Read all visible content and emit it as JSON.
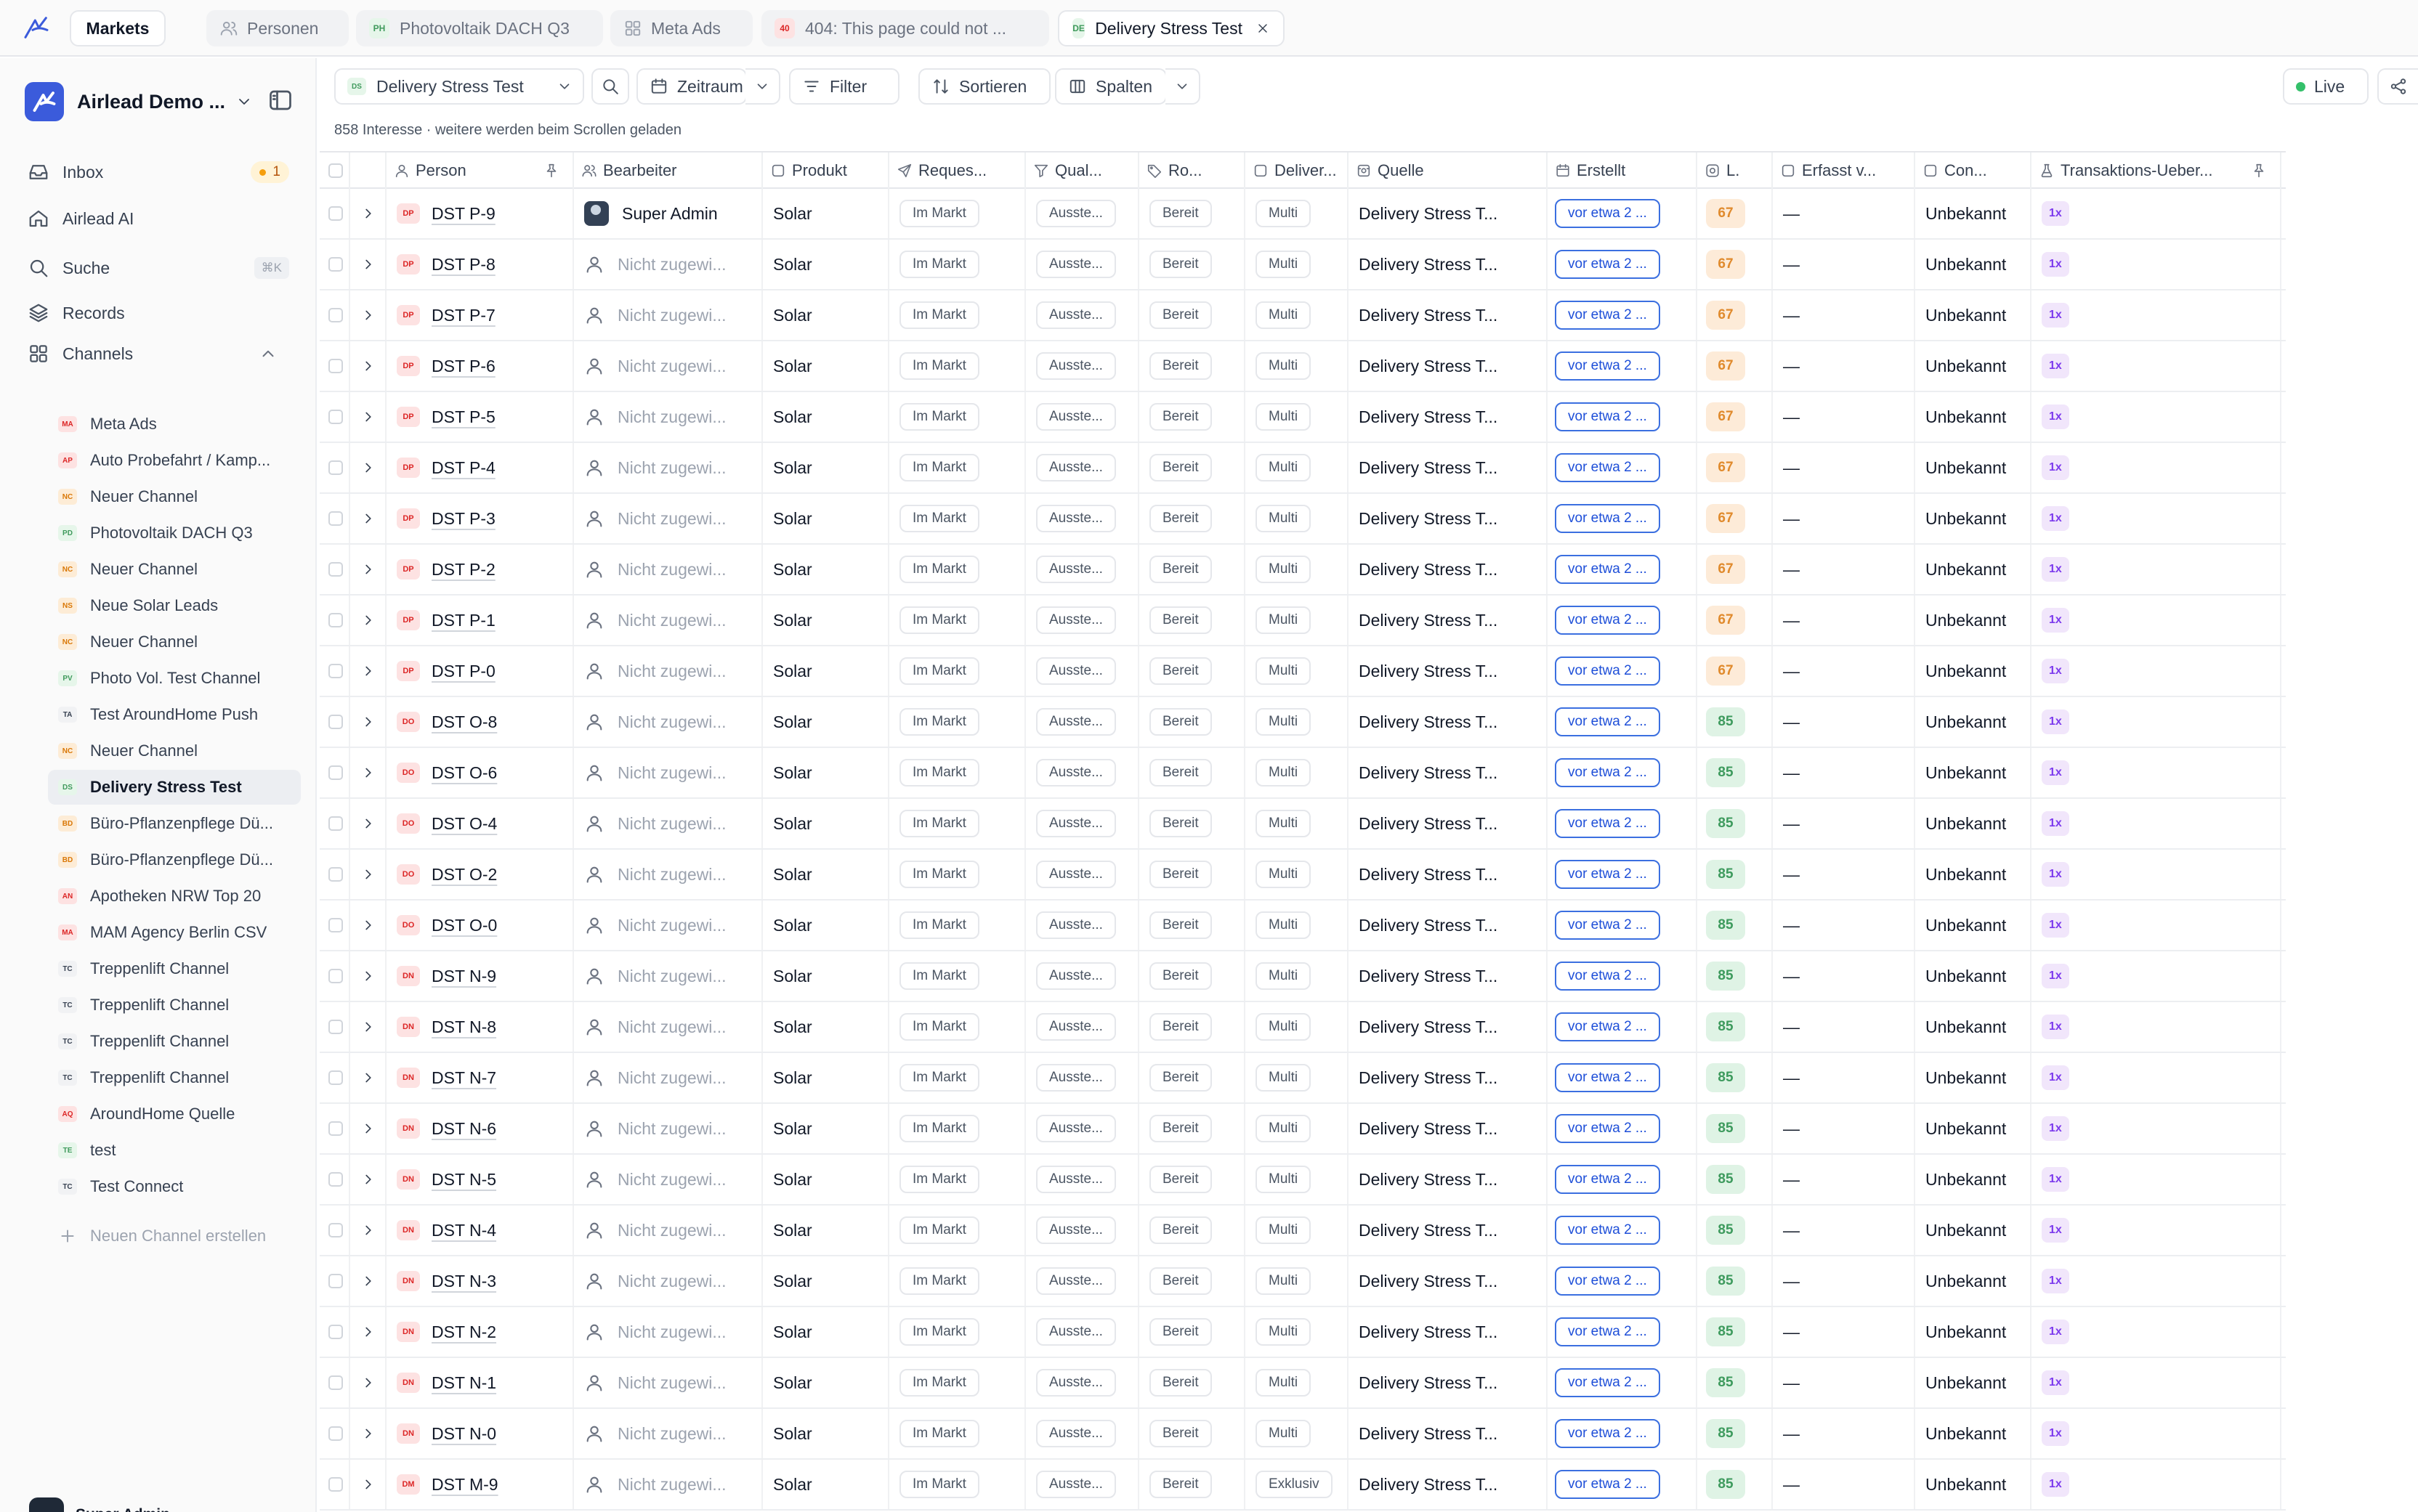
{
  "tabs": [
    {
      "label": "Markets",
      "kind": "text",
      "badge": ""
    },
    {
      "label": "Personen",
      "kind": "users-icon",
      "badge": ""
    },
    {
      "label": "Photovoltaik DACH Q3",
      "kind": "badge",
      "badge": "PH",
      "badge_bg": "#e6f6ea",
      "badge_fg": "#3f9a5c"
    },
    {
      "label": "Meta Ads",
      "kind": "grid-icon",
      "badge": ""
    },
    {
      "label": "404: This page could not ...",
      "kind": "badge",
      "badge": "40",
      "badge_bg": "#fde2e2",
      "badge_fg": "#dc2626"
    },
    {
      "label": "Delivery Stress Test",
      "kind": "badge",
      "badge": "DE",
      "badge_bg": "#e6f6ea",
      "badge_fg": "#3f9a5c"
    }
  ],
  "workspace": {
    "name": "Airlead Demo ..."
  },
  "nav": [
    {
      "label": "Inbox",
      "icon": "inbox-icon",
      "count": "1"
    },
    {
      "label": "Airlead AI",
      "icon": "home-icon"
    },
    {
      "label": "Suche",
      "icon": "search-icon",
      "shortcut": "⌘K"
    },
    {
      "label": "Records",
      "icon": "layers-icon"
    },
    {
      "label": "Channels",
      "icon": "grid-icon"
    }
  ],
  "channels": [
    {
      "badge": "MA",
      "label": "Meta Ads",
      "bg": "#fde2e2",
      "fg": "#dc2626"
    },
    {
      "badge": "AP",
      "label": "Auto Probefahrt / Kamp...",
      "bg": "#fde2e2",
      "fg": "#dc2626"
    },
    {
      "badge": "NC",
      "label": "Neuer Channel",
      "bg": "#fdecd6",
      "fg": "#d97706"
    },
    {
      "badge": "PD",
      "label": "Photovoltaik DACH Q3",
      "bg": "#e6f6ea",
      "fg": "#3f9a5c"
    },
    {
      "badge": "NC",
      "label": "Neuer Channel",
      "bg": "#fdecd6",
      "fg": "#d97706"
    },
    {
      "badge": "NS",
      "label": "Neue Solar Leads",
      "bg": "#fdecd6",
      "fg": "#d97706"
    },
    {
      "badge": "NC",
      "label": "Neuer Channel",
      "bg": "#fdecd6",
      "fg": "#d97706"
    },
    {
      "badge": "PV",
      "label": "Photo Vol. Test Channel",
      "bg": "#e6f6ea",
      "fg": "#3f9a5c"
    },
    {
      "badge": "TA",
      "label": "Test AroundHome Push",
      "bg": "#f1f2f4",
      "fg": "#374151"
    },
    {
      "badge": "NC",
      "label": "Neuer Channel",
      "bg": "#fdecd6",
      "fg": "#d97706"
    },
    {
      "badge": "DS",
      "label": "Delivery Stress Test",
      "bg": "#e6f6ea",
      "fg": "#3f9a5c",
      "active": true
    },
    {
      "badge": "BD",
      "label": "Büro-Pflanzenpflege Dü...",
      "bg": "#fdecd6",
      "fg": "#d97706"
    },
    {
      "badge": "BD",
      "label": "Büro-Pflanzenpflege Dü...",
      "bg": "#fdecd6",
      "fg": "#d97706"
    },
    {
      "badge": "AN",
      "label": "Apotheken NRW Top 20",
      "bg": "#fde2e2",
      "fg": "#dc2626"
    },
    {
      "badge": "MA",
      "label": "MAM Agency Berlin CSV",
      "bg": "#fde2e2",
      "fg": "#dc2626"
    },
    {
      "badge": "TC",
      "label": "Treppenlift Channel",
      "bg": "#f1f2f4",
      "fg": "#374151"
    },
    {
      "badge": "TC",
      "label": "Treppenlift Channel",
      "bg": "#f1f2f4",
      "fg": "#374151"
    },
    {
      "badge": "TC",
      "label": "Treppenlift Channel",
      "bg": "#f1f2f4",
      "fg": "#374151"
    },
    {
      "badge": "TC",
      "label": "Treppenlift Channel",
      "bg": "#f1f2f4",
      "fg": "#374151"
    },
    {
      "badge": "AQ",
      "label": "AroundHome Quelle",
      "bg": "#fde2e2",
      "fg": "#dc2626"
    },
    {
      "badge": "TE",
      "label": "test",
      "bg": "#e6f6ea",
      "fg": "#3f9a5c"
    },
    {
      "badge": "TC",
      "label": "Test Connect",
      "bg": "#f1f2f4",
      "fg": "#374151"
    }
  ],
  "add_channel_label": "Neuen Channel erstellen",
  "user": {
    "name": "Super Admin"
  },
  "toolbar": {
    "view_badge": "DS",
    "view_label": "Delivery Stress Test",
    "zeitraum": "Zeitraum",
    "filter": "Filter",
    "sortieren": "Sortieren",
    "spalten": "Spalten",
    "live": "Live"
  },
  "info_text": "858 Interesse · weitere werden beim Scrollen geladen",
  "columns": [
    {
      "label": "Person",
      "icon": "user-icon",
      "pin": true
    },
    {
      "label": "Bearbeiter",
      "icon": "users-icon"
    },
    {
      "label": "Produkt",
      "icon": "box-icon"
    },
    {
      "label": "Reques...",
      "icon": "send-icon"
    },
    {
      "label": "Qual...",
      "icon": "funnel-icon"
    },
    {
      "label": "Ro...",
      "icon": "tag-icon"
    },
    {
      "label": "Deliver...",
      "icon": "box-icon"
    },
    {
      "label": "Quelle",
      "icon": "source-icon"
    },
    {
      "label": "Erstellt",
      "icon": "calendar-icon"
    },
    {
      "label": "L.",
      "icon": "target-icon"
    },
    {
      "label": "Erfasst v...",
      "icon": "box-icon"
    },
    {
      "label": "Con...",
      "icon": "box-icon"
    },
    {
      "label": "Transaktions-Ueber...",
      "icon": "flask-icon",
      "pin": true
    }
  ],
  "rows": [
    {
      "badge": "DP",
      "name": "DST P-9",
      "assignee": "Super Admin",
      "assigned": true,
      "product": "Solar",
      "request": "Im Markt",
      "qual": "Ausste...",
      "role": "Bereit",
      "delivery": "Multi",
      "source": "Delivery Stress T...",
      "created": "vor etwa 2 ...",
      "score": "67",
      "erfasst": "—",
      "con": "Unbekannt",
      "tx": "1x"
    },
    {
      "badge": "DP",
      "name": "DST P-8",
      "assignee": "Nicht zugewi...",
      "assigned": false,
      "product": "Solar",
      "request": "Im Markt",
      "qual": "Ausste...",
      "role": "Bereit",
      "delivery": "Multi",
      "source": "Delivery Stress T...",
      "created": "vor etwa 2 ...",
      "score": "67",
      "erfasst": "—",
      "con": "Unbekannt",
      "tx": "1x"
    },
    {
      "badge": "DP",
      "name": "DST P-7",
      "assignee": "Nicht zugewi...",
      "assigned": false,
      "product": "Solar",
      "request": "Im Markt",
      "qual": "Ausste...",
      "role": "Bereit",
      "delivery": "Multi",
      "source": "Delivery Stress T...",
      "created": "vor etwa 2 ...",
      "score": "67",
      "erfasst": "—",
      "con": "Unbekannt",
      "tx": "1x"
    },
    {
      "badge": "DP",
      "name": "DST P-6",
      "assignee": "Nicht zugewi...",
      "assigned": false,
      "product": "Solar",
      "request": "Im Markt",
      "qual": "Ausste...",
      "role": "Bereit",
      "delivery": "Multi",
      "source": "Delivery Stress T...",
      "created": "vor etwa 2 ...",
      "score": "67",
      "erfasst": "—",
      "con": "Unbekannt",
      "tx": "1x"
    },
    {
      "badge": "DP",
      "name": "DST P-5",
      "assignee": "Nicht zugewi...",
      "assigned": false,
      "product": "Solar",
      "request": "Im Markt",
      "qual": "Ausste...",
      "role": "Bereit",
      "delivery": "Multi",
      "source": "Delivery Stress T...",
      "created": "vor etwa 2 ...",
      "score": "67",
      "erfasst": "—",
      "con": "Unbekannt",
      "tx": "1x"
    },
    {
      "badge": "DP",
      "name": "DST P-4",
      "assignee": "Nicht zugewi...",
      "assigned": false,
      "product": "Solar",
      "request": "Im Markt",
      "qual": "Ausste...",
      "role": "Bereit",
      "delivery": "Multi",
      "source": "Delivery Stress T...",
      "created": "vor etwa 2 ...",
      "score": "67",
      "erfasst": "—",
      "con": "Unbekannt",
      "tx": "1x"
    },
    {
      "badge": "DP",
      "name": "DST P-3",
      "assignee": "Nicht zugewi...",
      "assigned": false,
      "product": "Solar",
      "request": "Im Markt",
      "qual": "Ausste...",
      "role": "Bereit",
      "delivery": "Multi",
      "source": "Delivery Stress T...",
      "created": "vor etwa 2 ...",
      "score": "67",
      "erfasst": "—",
      "con": "Unbekannt",
      "tx": "1x"
    },
    {
      "badge": "DP",
      "name": "DST P-2",
      "assignee": "Nicht zugewi...",
      "assigned": false,
      "product": "Solar",
      "request": "Im Markt",
      "qual": "Ausste...",
      "role": "Bereit",
      "delivery": "Multi",
      "source": "Delivery Stress T...",
      "created": "vor etwa 2 ...",
      "score": "67",
      "erfasst": "—",
      "con": "Unbekannt",
      "tx": "1x"
    },
    {
      "badge": "DP",
      "name": "DST P-1",
      "assignee": "Nicht zugewi...",
      "assigned": false,
      "product": "Solar",
      "request": "Im Markt",
      "qual": "Ausste...",
      "role": "Bereit",
      "delivery": "Multi",
      "source": "Delivery Stress T...",
      "created": "vor etwa 2 ...",
      "score": "67",
      "erfasst": "—",
      "con": "Unbekannt",
      "tx": "1x"
    },
    {
      "badge": "DP",
      "name": "DST P-0",
      "assignee": "Nicht zugewi...",
      "assigned": false,
      "product": "Solar",
      "request": "Im Markt",
      "qual": "Ausste...",
      "role": "Bereit",
      "delivery": "Multi",
      "source": "Delivery Stress T...",
      "created": "vor etwa 2 ...",
      "score": "67",
      "erfasst": "—",
      "con": "Unbekannt",
      "tx": "1x"
    },
    {
      "badge": "DO",
      "name": "DST O-8",
      "assignee": "Nicht zugewi...",
      "assigned": false,
      "product": "Solar",
      "request": "Im Markt",
      "qual": "Ausste...",
      "role": "Bereit",
      "delivery": "Multi",
      "source": "Delivery Stress T...",
      "created": "vor etwa 2 ...",
      "score": "85",
      "erfasst": "—",
      "con": "Unbekannt",
      "tx": "1x"
    },
    {
      "badge": "DO",
      "name": "DST O-6",
      "assignee": "Nicht zugewi...",
      "assigned": false,
      "product": "Solar",
      "request": "Im Markt",
      "qual": "Ausste...",
      "role": "Bereit",
      "delivery": "Multi",
      "source": "Delivery Stress T...",
      "created": "vor etwa 2 ...",
      "score": "85",
      "erfasst": "—",
      "con": "Unbekannt",
      "tx": "1x"
    },
    {
      "badge": "DO",
      "name": "DST O-4",
      "assignee": "Nicht zugewi...",
      "assigned": false,
      "product": "Solar",
      "request": "Im Markt",
      "qual": "Ausste...",
      "role": "Bereit",
      "delivery": "Multi",
      "source": "Delivery Stress T...",
      "created": "vor etwa 2 ...",
      "score": "85",
      "erfasst": "—",
      "con": "Unbekannt",
      "tx": "1x"
    },
    {
      "badge": "DO",
      "name": "DST O-2",
      "assignee": "Nicht zugewi...",
      "assigned": false,
      "product": "Solar",
      "request": "Im Markt",
      "qual": "Ausste...",
      "role": "Bereit",
      "delivery": "Multi",
      "source": "Delivery Stress T...",
      "created": "vor etwa 2 ...",
      "score": "85",
      "erfasst": "—",
      "con": "Unbekannt",
      "tx": "1x"
    },
    {
      "badge": "DO",
      "name": "DST O-0",
      "assignee": "Nicht zugewi...",
      "assigned": false,
      "product": "Solar",
      "request": "Im Markt",
      "qual": "Ausste...",
      "role": "Bereit",
      "delivery": "Multi",
      "source": "Delivery Stress T...",
      "created": "vor etwa 2 ...",
      "score": "85",
      "erfasst": "—",
      "con": "Unbekannt",
      "tx": "1x"
    },
    {
      "badge": "DN",
      "name": "DST N-9",
      "assignee": "Nicht zugewi...",
      "assigned": false,
      "product": "Solar",
      "request": "Im Markt",
      "qual": "Ausste...",
      "role": "Bereit",
      "delivery": "Multi",
      "source": "Delivery Stress T...",
      "created": "vor etwa 2 ...",
      "score": "85",
      "erfasst": "—",
      "con": "Unbekannt",
      "tx": "1x"
    },
    {
      "badge": "DN",
      "name": "DST N-8",
      "assignee": "Nicht zugewi...",
      "assigned": false,
      "product": "Solar",
      "request": "Im Markt",
      "qual": "Ausste...",
      "role": "Bereit",
      "delivery": "Multi",
      "source": "Delivery Stress T...",
      "created": "vor etwa 2 ...",
      "score": "85",
      "erfasst": "—",
      "con": "Unbekannt",
      "tx": "1x"
    },
    {
      "badge": "DN",
      "name": "DST N-7",
      "assignee": "Nicht zugewi...",
      "assigned": false,
      "product": "Solar",
      "request": "Im Markt",
      "qual": "Ausste...",
      "role": "Bereit",
      "delivery": "Multi",
      "source": "Delivery Stress T...",
      "created": "vor etwa 2 ...",
      "score": "85",
      "erfasst": "—",
      "con": "Unbekannt",
      "tx": "1x"
    },
    {
      "badge": "DN",
      "name": "DST N-6",
      "assignee": "Nicht zugewi...",
      "assigned": false,
      "product": "Solar",
      "request": "Im Markt",
      "qual": "Ausste...",
      "role": "Bereit",
      "delivery": "Multi",
      "source": "Delivery Stress T...",
      "created": "vor etwa 2 ...",
      "score": "85",
      "erfasst": "—",
      "con": "Unbekannt",
      "tx": "1x"
    },
    {
      "badge": "DN",
      "name": "DST N-5",
      "assignee": "Nicht zugewi...",
      "assigned": false,
      "product": "Solar",
      "request": "Im Markt",
      "qual": "Ausste...",
      "role": "Bereit",
      "delivery": "Multi",
      "source": "Delivery Stress T...",
      "created": "vor etwa 2 ...",
      "score": "85",
      "erfasst": "—",
      "con": "Unbekannt",
      "tx": "1x"
    },
    {
      "badge": "DN",
      "name": "DST N-4",
      "assignee": "Nicht zugewi...",
      "assigned": false,
      "product": "Solar",
      "request": "Im Markt",
      "qual": "Ausste...",
      "role": "Bereit",
      "delivery": "Multi",
      "source": "Delivery Stress T...",
      "created": "vor etwa 2 ...",
      "score": "85",
      "erfasst": "—",
      "con": "Unbekannt",
      "tx": "1x"
    },
    {
      "badge": "DN",
      "name": "DST N-3",
      "assignee": "Nicht zugewi...",
      "assigned": false,
      "product": "Solar",
      "request": "Im Markt",
      "qual": "Ausste...",
      "role": "Bereit",
      "delivery": "Multi",
      "source": "Delivery Stress T...",
      "created": "vor etwa 2 ...",
      "score": "85",
      "erfasst": "—",
      "con": "Unbekannt",
      "tx": "1x"
    },
    {
      "badge": "DN",
      "name": "DST N-2",
      "assignee": "Nicht zugewi...",
      "assigned": false,
      "product": "Solar",
      "request": "Im Markt",
      "qual": "Ausste...",
      "role": "Bereit",
      "delivery": "Multi",
      "source": "Delivery Stress T...",
      "created": "vor etwa 2 ...",
      "score": "85",
      "erfasst": "—",
      "con": "Unbekannt",
      "tx": "1x"
    },
    {
      "badge": "DN",
      "name": "DST N-1",
      "assignee": "Nicht zugewi...",
      "assigned": false,
      "product": "Solar",
      "request": "Im Markt",
      "qual": "Ausste...",
      "role": "Bereit",
      "delivery": "Multi",
      "source": "Delivery Stress T...",
      "created": "vor etwa 2 ...",
      "score": "85",
      "erfasst": "—",
      "con": "Unbekannt",
      "tx": "1x"
    },
    {
      "badge": "DN",
      "name": "DST N-0",
      "assignee": "Nicht zugewi...",
      "assigned": false,
      "product": "Solar",
      "request": "Im Markt",
      "qual": "Ausste...",
      "role": "Bereit",
      "delivery": "Multi",
      "source": "Delivery Stress T...",
      "created": "vor etwa 2 ...",
      "score": "85",
      "erfasst": "—",
      "con": "Unbekannt",
      "tx": "1x"
    },
    {
      "badge": "DM",
      "name": "DST M-9",
      "assignee": "Nicht zugewi...",
      "assigned": false,
      "product": "Solar",
      "request": "Im Markt",
      "qual": "Ausste...",
      "role": "Bereit",
      "delivery": "Exklusiv",
      "source": "Delivery Stress T...",
      "created": "vor etwa 2 ...",
      "score": "85",
      "erfasst": "—",
      "con": "Unbekannt",
      "tx": "1x"
    }
  ]
}
